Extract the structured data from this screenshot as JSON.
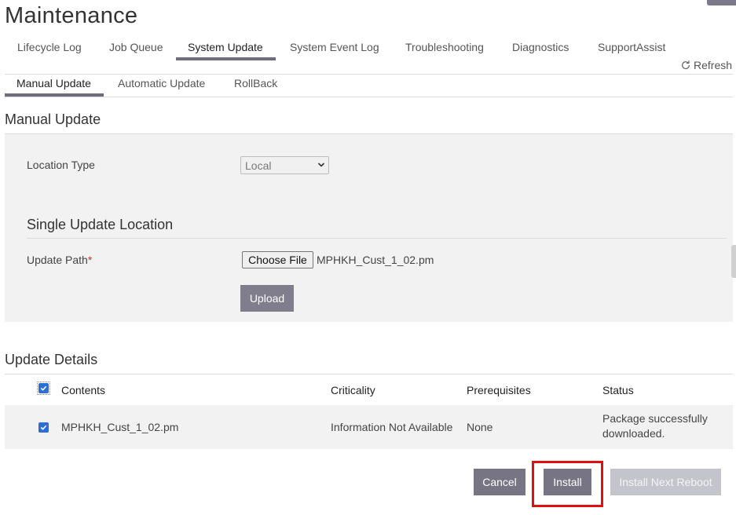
{
  "page": {
    "title": "Maintenance"
  },
  "tabs": [
    {
      "label": "Lifecycle Log",
      "active": false
    },
    {
      "label": "Job Queue",
      "active": false
    },
    {
      "label": "System Update",
      "active": true
    },
    {
      "label": "System Event Log",
      "active": false
    },
    {
      "label": "Troubleshooting",
      "active": false
    },
    {
      "label": "Diagnostics",
      "active": false
    },
    {
      "label": "SupportAssist",
      "active": false
    }
  ],
  "refresh": {
    "label": "Refresh",
    "icon": "refresh-icon"
  },
  "subtabs": [
    {
      "label": "Manual Update",
      "active": true
    },
    {
      "label": "Automatic Update",
      "active": false
    },
    {
      "label": "RollBack",
      "active": false
    }
  ],
  "manual_update": {
    "section_title": "Manual Update",
    "location_type_label": "Location Type",
    "location_type_value": "Local",
    "single_update_title": "Single Update Location",
    "update_path_label": "Update Path",
    "required_marker": "*",
    "choose_file_label": "Choose File",
    "file_name": "MPHKH_Cust_1_02.pm",
    "upload_label": "Upload"
  },
  "update_details": {
    "section_title": "Update Details",
    "columns": [
      "Contents",
      "Criticality",
      "Prerequisites",
      "Status"
    ],
    "rows": [
      {
        "contents": "MPHKH_Cust_1_02.pm",
        "criticality": "Information Not Available",
        "prerequisites": "None",
        "status": "Package successfully downloaded.",
        "checked": true
      }
    ],
    "select_all_checked": true
  },
  "actions": {
    "cancel_label": "Cancel",
    "install_label": "Install",
    "install_next_reboot_label": "Install Next Reboot"
  },
  "colors": {
    "button": "#777584",
    "button_disabled": "#c4c4cc",
    "checkbox": "#2b6fd6",
    "highlight": "#e01010",
    "required": "#c0392b"
  }
}
